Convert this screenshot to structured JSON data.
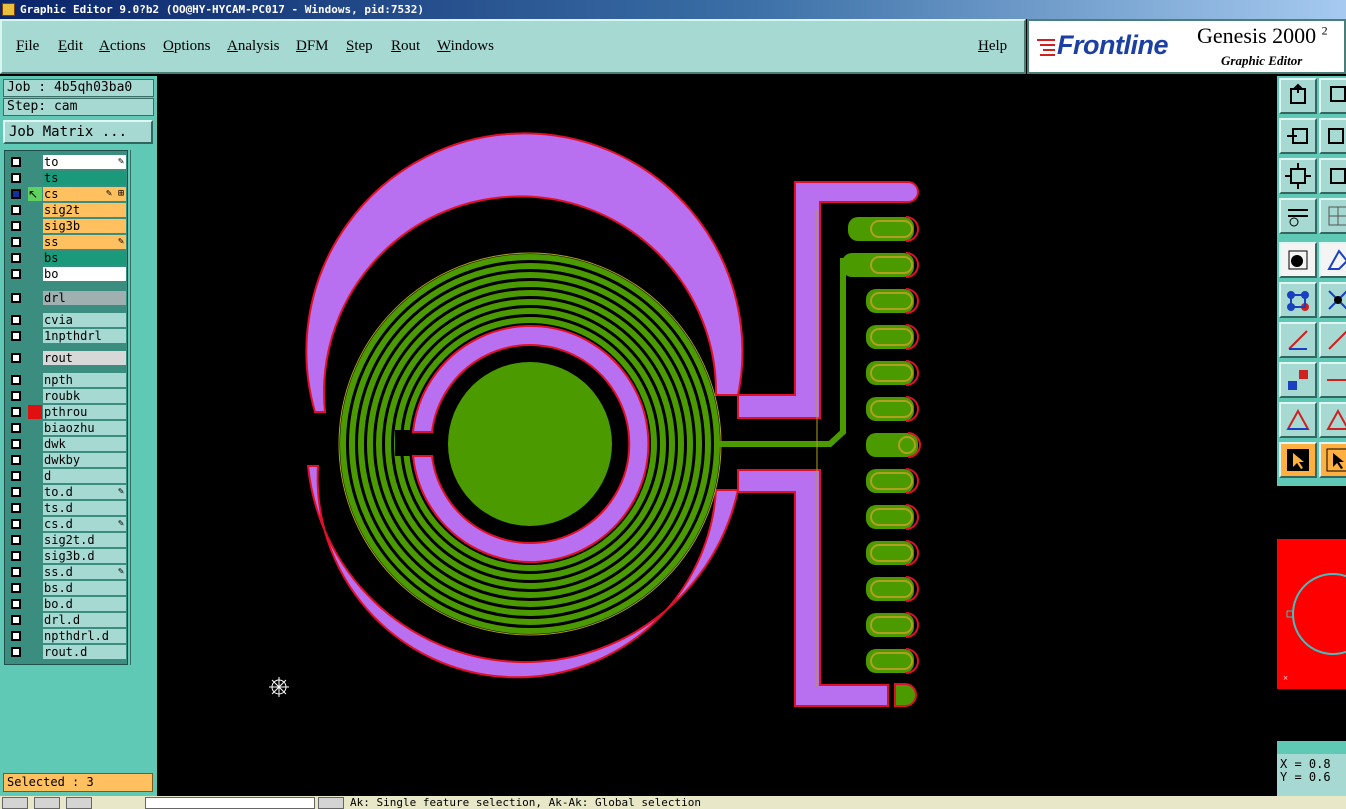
{
  "window": {
    "title": "Graphic Editor 9.0?b2 (OO@HY-HYCAM-PC017 - Windows, pid:7532)"
  },
  "menu": {
    "items": [
      "File",
      "Edit",
      "Actions",
      "Options",
      "Analysis",
      "DFM",
      "Step",
      "Rout",
      "Windows"
    ],
    "help": "Help"
  },
  "logo": {
    "brand": "Frontline",
    "product": "Genesis 2000",
    "superscript": "2",
    "subtitle": "Graphic Editor"
  },
  "job": {
    "job_label": "Job : 4b5qh03ba0",
    "step_label": "Step: cam",
    "matrix_button": "Job Matrix ..."
  },
  "layers": [
    {
      "name": "to",
      "color": "#ffffff",
      "mark": "✎"
    },
    {
      "name": "ts",
      "color": "#1a9a7a",
      "mark": ""
    },
    {
      "name": "cs",
      "color": "#ffc060",
      "mark": "✎ ⊞",
      "work": true
    },
    {
      "name": "sig2t",
      "color": "#ffc060",
      "mark": ""
    },
    {
      "name": "sig3b",
      "color": "#ffc060",
      "mark": ""
    },
    {
      "name": "ss",
      "color": "#ffc060",
      "mark": "✎"
    },
    {
      "name": "bs",
      "color": "#1a9a7a",
      "mark": ""
    },
    {
      "name": "bo",
      "color": "#ffffff",
      "mark": ""
    },
    {
      "name": "drl",
      "color": "#a0b0b0",
      "mark": ""
    },
    {
      "name": "cvia",
      "color": "#a5d9d2",
      "mark": ""
    },
    {
      "name": "1npthdrl",
      "color": "#a5d9d2",
      "mark": ""
    },
    {
      "name": "rout",
      "color": "#d8d8d8",
      "mark": ""
    },
    {
      "name": "npth",
      "color": "#a5d9d2",
      "mark": ""
    },
    {
      "name": "roubk",
      "color": "#a5d9d2",
      "mark": ""
    },
    {
      "name": "pthrou",
      "color": "#a5d9d2",
      "mark": "",
      "red": true
    },
    {
      "name": "biaozhu",
      "color": "#a5d9d2",
      "mark": ""
    },
    {
      "name": "dwk",
      "color": "#a5d9d2",
      "mark": ""
    },
    {
      "name": "dwkby",
      "color": "#a5d9d2",
      "mark": ""
    },
    {
      "name": "d",
      "color": "#a5d9d2",
      "mark": ""
    },
    {
      "name": "to.d",
      "color": "#a5d9d2",
      "mark": "✎"
    },
    {
      "name": "ts.d",
      "color": "#a5d9d2",
      "mark": ""
    },
    {
      "name": "cs.d",
      "color": "#a5d9d2",
      "mark": "✎"
    },
    {
      "name": "sig2t.d",
      "color": "#a5d9d2",
      "mark": ""
    },
    {
      "name": "sig3b.d",
      "color": "#a5d9d2",
      "mark": ""
    },
    {
      "name": "ss.d",
      "color": "#a5d9d2",
      "mark": "✎"
    },
    {
      "name": "bs.d",
      "color": "#a5d9d2",
      "mark": ""
    },
    {
      "name": "bo.d",
      "color": "#a5d9d2",
      "mark": ""
    },
    {
      "name": "drl.d",
      "color": "#a5d9d2",
      "mark": ""
    },
    {
      "name": "npthdrl.d",
      "color": "#a5d9d2",
      "mark": ""
    },
    {
      "name": "rout.d",
      "color": "#a5d9d2",
      "mark": ""
    }
  ],
  "status": {
    "selected": "Selected : 3"
  },
  "coords": {
    "x": "X = 0.8",
    "y": "Y = 0.6"
  },
  "colors": {
    "feature_selected": "#b870f0",
    "feature_green": "#4a9a00",
    "feature_outline": "#e0102a",
    "gold": "#b0a020"
  },
  "bottom": {
    "message": "Ak: Single feature selection, Ak-Ak: Global selection"
  }
}
